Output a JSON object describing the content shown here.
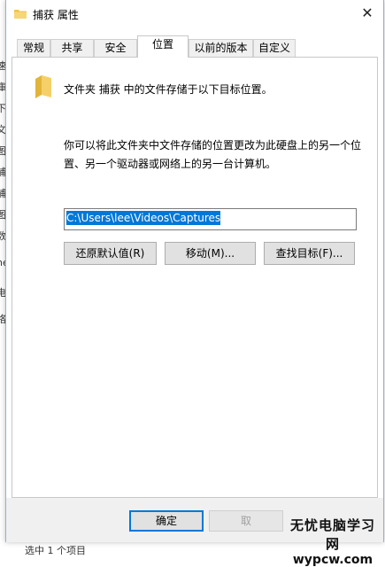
{
  "background": {
    "left_chars": [
      "速",
      "庫",
      "下",
      "文",
      "图",
      "捕",
      "捕",
      "图",
      "数",
      "ne",
      "电",
      "络"
    ],
    "status_text": "选中 1 个项目"
  },
  "window": {
    "title": "捕获 属性",
    "close_glyph": "✕"
  },
  "tabs": [
    {
      "label": "常规"
    },
    {
      "label": "共享"
    },
    {
      "label": "安全"
    },
    {
      "label": "位置"
    },
    {
      "label": "以前的版本"
    },
    {
      "label": "自定义"
    }
  ],
  "location": {
    "description": "文件夹 捕获 中的文件存储于以下目标位置。",
    "help_text": "你可以将此文件夹中文件存储的位置更改为此硬盘上的另一个位置、另一个驱动器或网络上的另一台计算机。",
    "path_value": "C:\\Users\\lee\\Videos\\Captures",
    "restore_default_label": "还原默认值(R)",
    "move_label": "移动(M)...",
    "find_target_label": "查找目标(F)..."
  },
  "footer": {
    "ok_label": "确定",
    "cancel_label": "取"
  },
  "watermark": {
    "line1": "无忧电脑学习网",
    "line2": "wypcw.com"
  }
}
